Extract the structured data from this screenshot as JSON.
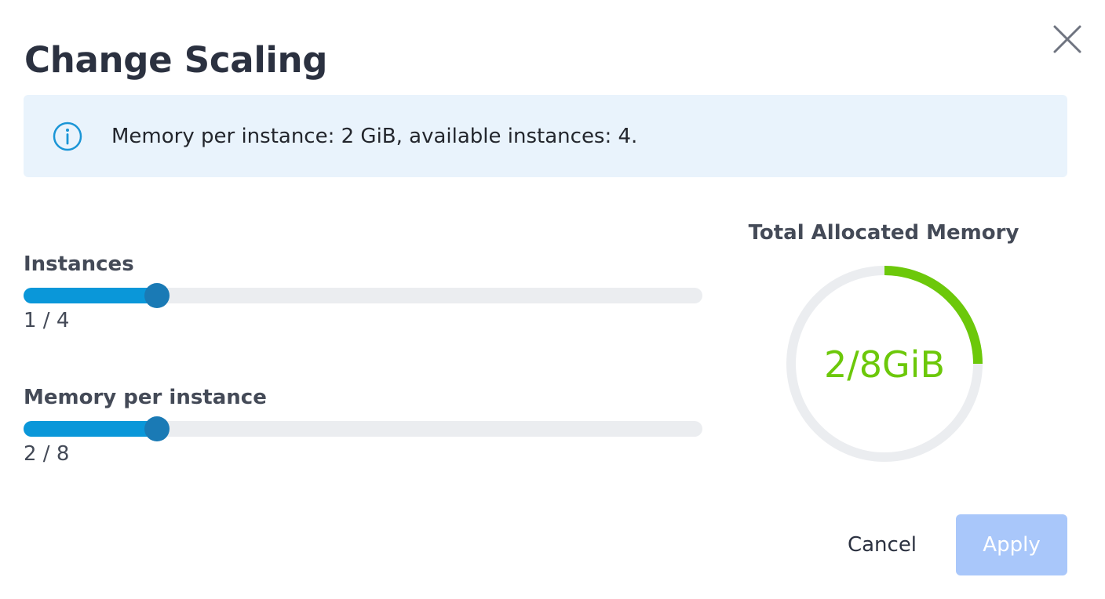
{
  "dialog": {
    "title": "Change Scaling",
    "close_icon": "close-icon"
  },
  "info": {
    "icon": "info-icon",
    "text": "Memory per instance: 2 GiB, available instances: 4."
  },
  "sliders": [
    {
      "label": "Instances",
      "value_text": "1 / 4",
      "value": 1,
      "max": 4,
      "fill_fraction": 0.197
    },
    {
      "label": "Memory per instance",
      "value_text": "2 / 8",
      "value": 2,
      "max": 8,
      "fill_fraction": 0.197
    }
  ],
  "gauge": {
    "title": "Total Allocated Memory",
    "value_text": "2/8GiB",
    "used": 2,
    "total": 8,
    "fraction": 0.25,
    "color_used": "#6cc80a",
    "color_track": "#ebedf0"
  },
  "actions": {
    "cancel_label": "Cancel",
    "apply_label": "Apply"
  },
  "colors": {
    "slider_fill": "#0a97d9",
    "slider_thumb": "#1a7ab5",
    "info_background": "#e9f3fc",
    "info_icon": "#1a95d6",
    "apply_disabled": "#a9c7fa"
  }
}
